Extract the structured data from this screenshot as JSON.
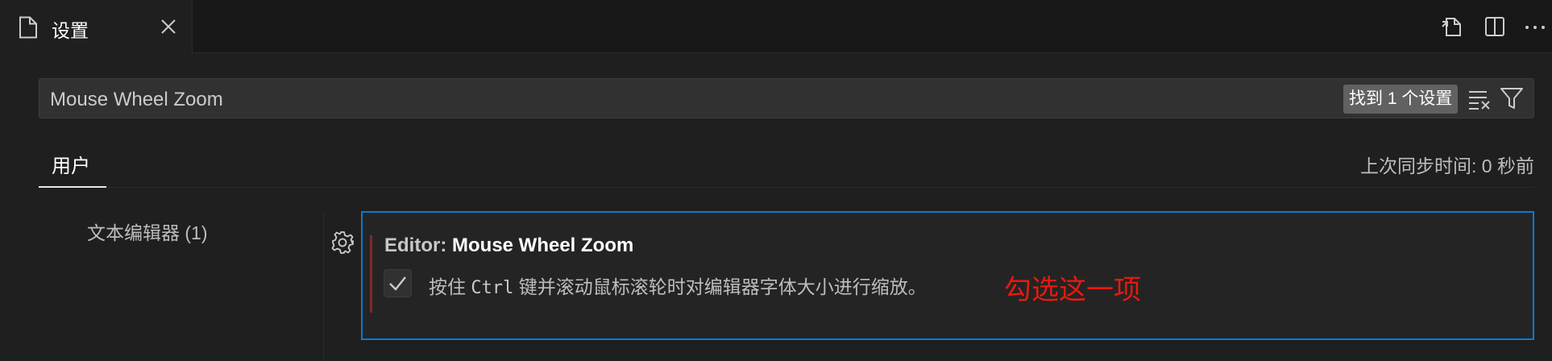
{
  "tab": {
    "title": "设置",
    "icon": "file-icon"
  },
  "toolbar": {
    "icons": [
      "open-settings-json-icon",
      "split-editor-icon",
      "more-actions-icon"
    ]
  },
  "search": {
    "value": "Mouse Wheel Zoom",
    "result_count": "找到 1 个设置"
  },
  "scope": {
    "user_tab": "用户",
    "sync_status": "上次同步时间: 0 秒前"
  },
  "toc": {
    "item": "文本编辑器 (1)"
  },
  "setting": {
    "category": "Editor: ",
    "name": "Mouse Wheel Zoom",
    "checked": true,
    "desc_prefix": "按住 ",
    "desc_key": "Ctrl",
    "desc_suffix": " 键并滚动鼠标滚轮时对编辑器字体大小进行缩放。"
  },
  "annotation": {
    "text": "勾选这一项",
    "color": "#e8190e"
  },
  "colors": {
    "focus_border": "#0a7ad0",
    "modified_indicator": "#7e2a2a"
  }
}
